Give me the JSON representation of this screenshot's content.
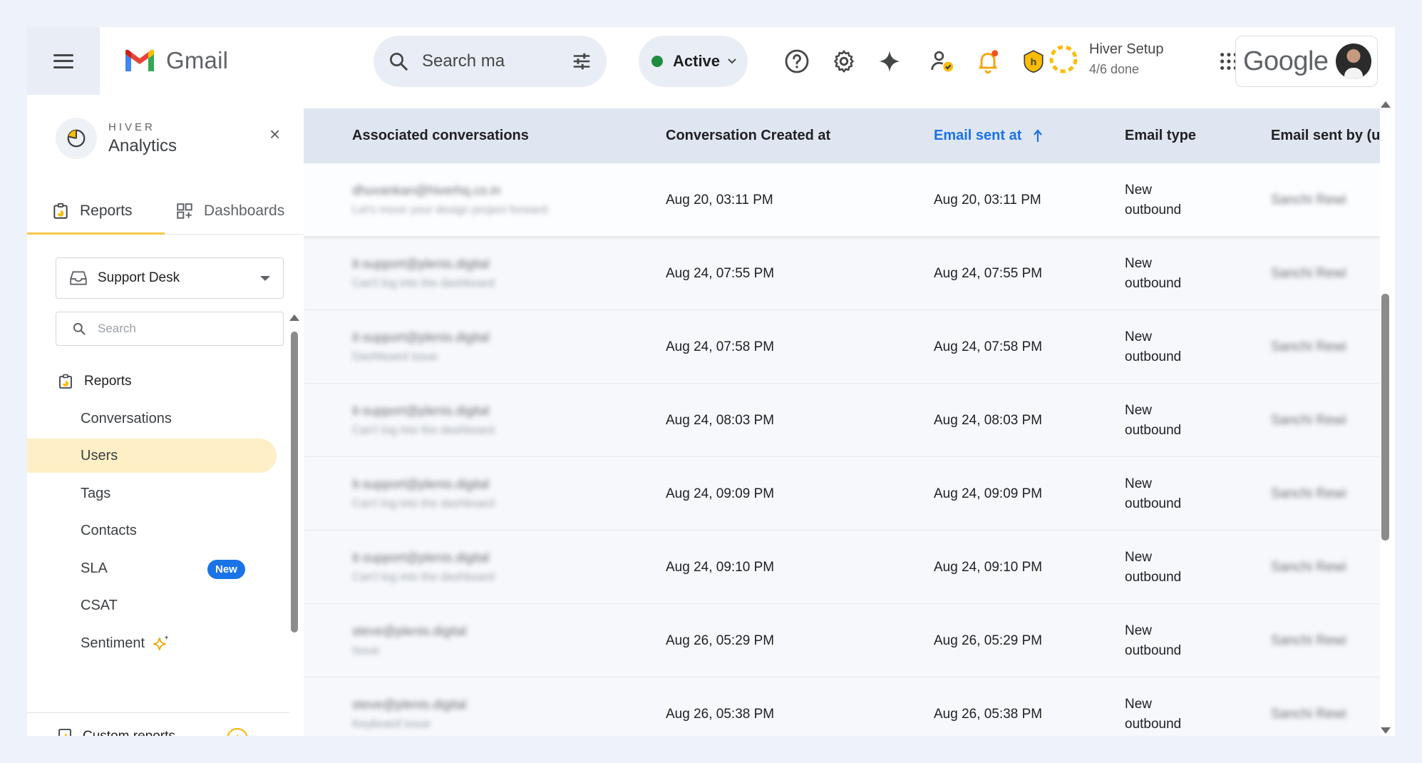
{
  "topbar": {
    "app_name": "Gmail",
    "search_placeholder": "Search ma",
    "status_label": "Active",
    "setup_title": "Hiver Setup",
    "setup_progress": "4/6 done",
    "setup_progress_fraction": 0.667,
    "google_label": "Google",
    "icons": [
      "menu-icon",
      "gmail-logo",
      "search-icon",
      "filter-sliders-icon",
      "help-icon",
      "gear-icon",
      "sparkle-icon",
      "user-status-icon",
      "bell-icon",
      "hiver-shield-icon",
      "setup-progress-ring",
      "apps-grid-icon",
      "avatar"
    ]
  },
  "sidebar": {
    "brand_small": "HIVER",
    "brand_big": "Analytics",
    "close_label": "×",
    "tabs": [
      {
        "label": "Reports",
        "active": true
      },
      {
        "label": "Dashboards",
        "active": false
      }
    ],
    "inbox_select": "Support Desk",
    "search_placeholder": "Search",
    "section_title": "Reports",
    "items": [
      {
        "label": "Conversations",
        "active": false
      },
      {
        "label": "Users",
        "active": true
      },
      {
        "label": "Tags",
        "active": false
      },
      {
        "label": "Contacts",
        "active": false
      },
      {
        "label": "SLA",
        "active": false,
        "badge": "New"
      },
      {
        "label": "CSAT",
        "active": false
      },
      {
        "label": "Sentiment",
        "active": false
      }
    ],
    "custom_reports": "Custom reports",
    "add_label": "+"
  },
  "table": {
    "columns": [
      {
        "label": "Associated conversations"
      },
      {
        "label": "Conversation Created at"
      },
      {
        "label": "Email sent at",
        "sorted": "asc"
      },
      {
        "label": "Email type"
      },
      {
        "label": "Email sent by (u"
      }
    ],
    "rows": [
      {
        "conv_email": "dhuvankan@hiverhq.co.in",
        "conv_subject": "Let's move your design project forward",
        "created_at": "Aug 20, 03:11 PM",
        "sent_at": "Aug 20, 03:11 PM",
        "type_line1": "New",
        "type_line2": "outbound",
        "sent_by": "Sanchi Rewi"
      },
      {
        "conv_email": "it-support@plenis.digital",
        "conv_subject": "Can't log into the dashboard",
        "created_at": "Aug 24, 07:55 PM",
        "sent_at": "Aug 24, 07:55 PM",
        "type_line1": "New",
        "type_line2": "outbound",
        "sent_by": "Sanchi Rewi"
      },
      {
        "conv_email": "it-support@plenis.digital",
        "conv_subject": "Dashboard issue",
        "created_at": "Aug 24, 07:58 PM",
        "sent_at": "Aug 24, 07:58 PM",
        "type_line1": "New",
        "type_line2": "outbound",
        "sent_by": "Sanchi Rewi"
      },
      {
        "conv_email": "it-support@plenis.digital",
        "conv_subject": "Can't log into the dashboard",
        "created_at": "Aug 24, 08:03 PM",
        "sent_at": "Aug 24, 08:03 PM",
        "type_line1": "New",
        "type_line2": "outbound",
        "sent_by": "Sanchi Rewi"
      },
      {
        "conv_email": "it-support@plenis.digital",
        "conv_subject": "Can't log into the dashboard",
        "created_at": "Aug 24, 09:09 PM",
        "sent_at": "Aug 24, 09:09 PM",
        "type_line1": "New",
        "type_line2": "outbound",
        "sent_by": "Sanchi Rewi"
      },
      {
        "conv_email": "it-support@plenis.digital",
        "conv_subject": "Can't log into the dashboard",
        "created_at": "Aug 24, 09:10 PM",
        "sent_at": "Aug 24, 09:10 PM",
        "type_line1": "New",
        "type_line2": "outbound",
        "sent_by": "Sanchi Rewi"
      },
      {
        "conv_email": "steve@plenis.digital",
        "conv_subject": "Issue",
        "created_at": "Aug 26, 05:29 PM",
        "sent_at": "Aug 26, 05:29 PM",
        "type_line1": "New",
        "type_line2": "outbound",
        "sent_by": "Sanchi Rewi"
      },
      {
        "conv_email": "steve@plenis.digital",
        "conv_subject": "Keyboard issue",
        "created_at": "Aug 26, 05:38 PM",
        "sent_at": "Aug 26, 05:38 PM",
        "type_line1": "New",
        "type_line2": "outbound",
        "sent_by": "Sanchi Rewi"
      }
    ]
  },
  "colors": {
    "accent_blue": "#1a73e8",
    "active_green": "#1e8e3e",
    "active_nav_bg": "#feefc7",
    "tab_underline": "#f5c84c",
    "header_bg": "#dfe6f2"
  }
}
